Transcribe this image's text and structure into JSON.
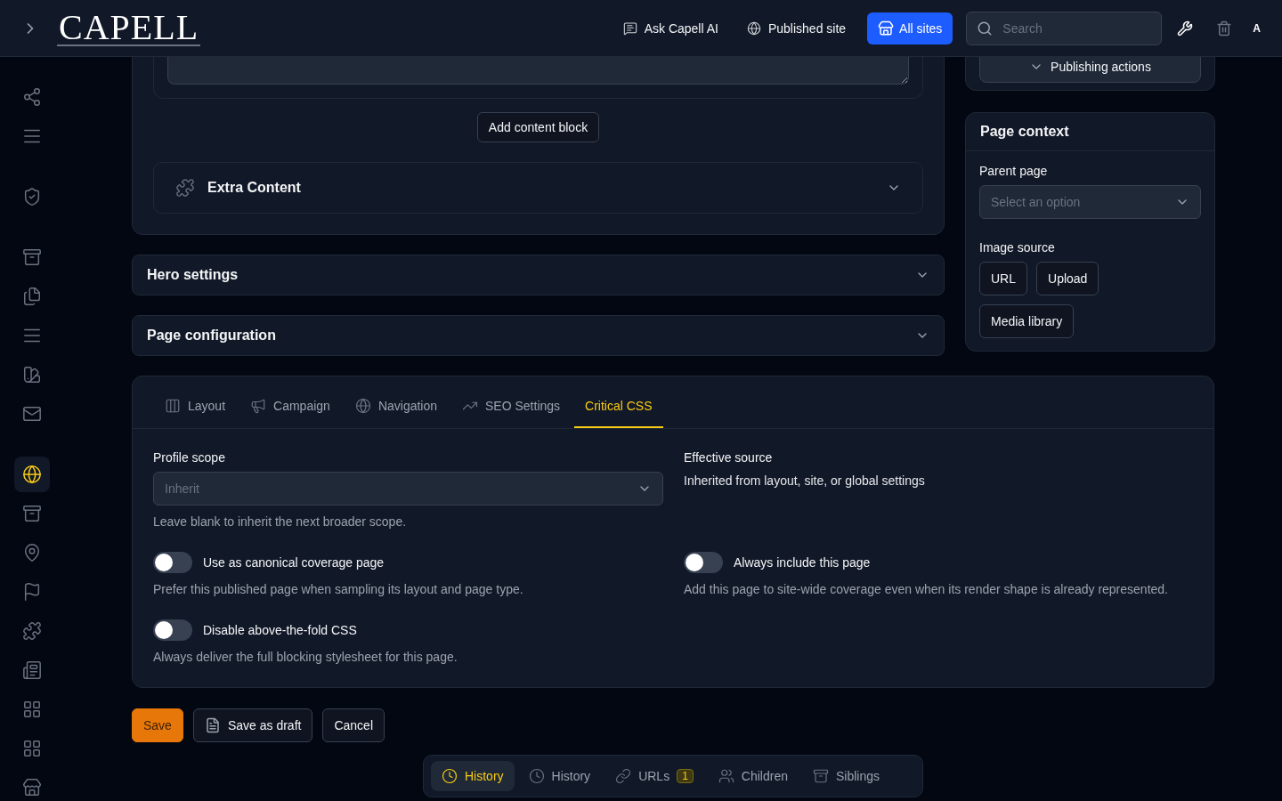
{
  "header": {
    "logo": "CAPELL",
    "actions": [
      {
        "kind": "ai",
        "label": "Ask Capell AI"
      },
      {
        "kind": "globe",
        "label": "Published site"
      }
    ],
    "sites_button": "All sites",
    "search": {
      "placeholder": "Search"
    },
    "avatar": "A"
  },
  "sidebar": {
    "groups": [
      [
        {
          "selected": false
        },
        {
          "selected": false
        }
      ],
      [
        {
          "selected": false
        }
      ],
      [
        {
          "selected": false
        },
        {
          "selected": false
        },
        {
          "selected": false
        },
        {
          "selected": false
        },
        {
          "selected": false
        }
      ],
      [
        {
          "selected": true
        },
        {
          "selected": false
        },
        {
          "selected": false
        },
        {
          "selected": false
        },
        {
          "selected": false
        },
        {
          "selected": false
        },
        {
          "selected": false
        },
        {
          "selected": false
        },
        {
          "selected": false
        }
      ]
    ]
  },
  "content_card": {
    "add_block_button": "Add content block",
    "extra_section": {
      "title": "Extra Content"
    }
  },
  "sections": [
    {
      "title": "Hero settings"
    },
    {
      "title": "Page configuration"
    }
  ],
  "publishing": {
    "button": "Publishing actions"
  },
  "page_context": {
    "title": "Page context",
    "parent_label": "Parent page",
    "parent_placeholder": "Select an option",
    "image_label": "Image source",
    "image_buttons": [
      "URL",
      "Upload",
      "Media library"
    ]
  },
  "tabs": [
    {
      "label": "Layout",
      "selected": false
    },
    {
      "label": "Campaign",
      "selected": false
    },
    {
      "label": "Navigation",
      "selected": false
    },
    {
      "label": "SEO Settings",
      "selected": false
    },
    {
      "label": "Critical CSS",
      "selected": true
    }
  ],
  "critical_css": {
    "scope_label": "Profile scope",
    "scope_value": "Inherit",
    "scope_hint": "Leave blank to inherit the next broader scope.",
    "source_label": "Effective source",
    "source_value": "Inherited from layout, site, or global settings",
    "toggles": [
      {
        "label": "Use as canonical coverage page",
        "hint": "Prefer this published page when sampling its layout and page type.",
        "on": false
      },
      {
        "label": "Always include this page",
        "hint": "Add this page to site-wide coverage even when its render shape is already represented.",
        "on": false
      },
      {
        "label": "Disable above-the-fold CSS",
        "hint": "Always deliver the full blocking stylesheet for this page.",
        "on": false
      }
    ]
  },
  "form_actions": [
    {
      "kind": "primary",
      "label": "Save"
    },
    {
      "kind": "draft",
      "label": "Save as draft"
    },
    {
      "kind": "plain",
      "label": "Cancel"
    }
  ],
  "bottom_tabs": [
    {
      "label": "History",
      "selected": true
    },
    {
      "label": "History",
      "selected": false
    },
    {
      "label": "URLs",
      "badge": "1",
      "selected": false
    },
    {
      "label": "Children",
      "selected": false
    },
    {
      "label": "Siblings",
      "selected": false
    }
  ]
}
